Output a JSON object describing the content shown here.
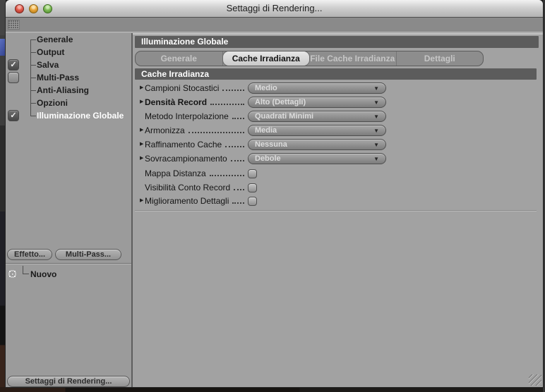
{
  "window": {
    "title": "Settaggi di Rendering..."
  },
  "icons": {
    "expand_arrow": "▶",
    "dropdown_arrow": "▼",
    "check": "✓"
  },
  "sidebar": {
    "items": [
      {
        "label": "Generale"
      },
      {
        "label": "Output"
      },
      {
        "label": "Salva",
        "checkbox": "checked"
      },
      {
        "label": "Multi-Pass",
        "checkbox": "unchecked"
      },
      {
        "label": "Anti-Aliasing"
      },
      {
        "label": "Opzioni"
      },
      {
        "label": "Illuminazione Globale",
        "checkbox": "checked",
        "selected": true
      }
    ],
    "effect_button": "Effetto...",
    "multipass_button": "Multi-Pass...",
    "render_list": {
      "items": [
        {
          "label": "Nuovo"
        }
      ]
    },
    "settings_button": "Settaggi di Rendering..."
  },
  "main": {
    "header": "Illuminazione Globale",
    "tabs": [
      {
        "label": "Generale",
        "selected": false
      },
      {
        "label": "Cache Irradianza",
        "selected": true
      },
      {
        "label": "File Cache Irradianza",
        "selected": false
      },
      {
        "label": "Dettagli",
        "selected": false
      }
    ],
    "section": "Cache Irradianza",
    "rows": [
      {
        "label": "Campioni Stocastici",
        "control": "dropdown",
        "value": "Medio",
        "arrow": true
      },
      {
        "label": "Densità Record",
        "control": "dropdown",
        "value": "Alto (Dettagli)",
        "arrow": true,
        "bold": true
      },
      {
        "label": "Metodo Interpolazione",
        "control": "dropdown",
        "value": "Quadrati Minimi",
        "arrow": false
      },
      {
        "label": "Armonizza",
        "control": "dropdown",
        "value": "Media",
        "arrow": true
      },
      {
        "label": "Raffinamento Cache",
        "control": "dropdown",
        "value": "Nessuna",
        "arrow": true
      },
      {
        "label": "Sovracampionamento",
        "control": "dropdown",
        "value": "Debole",
        "arrow": true
      },
      {
        "label": "Mappa Distanza",
        "control": "checkbox",
        "checked": false,
        "arrow": false
      },
      {
        "label": "Visibilità Conto Record",
        "control": "checkbox",
        "checked": false,
        "arrow": false
      },
      {
        "label": "Miglioramento Dettagli",
        "control": "checkbox",
        "checked": false,
        "arrow": true
      }
    ]
  },
  "colors": {
    "header_bar": "#5c5c5c",
    "selected_tab_bg": "#d8d8d8",
    "sidebar_bg": "#9b9b9b",
    "panel_bg": "#a2a2a2",
    "titlebar_top": "#f2f2f2"
  }
}
